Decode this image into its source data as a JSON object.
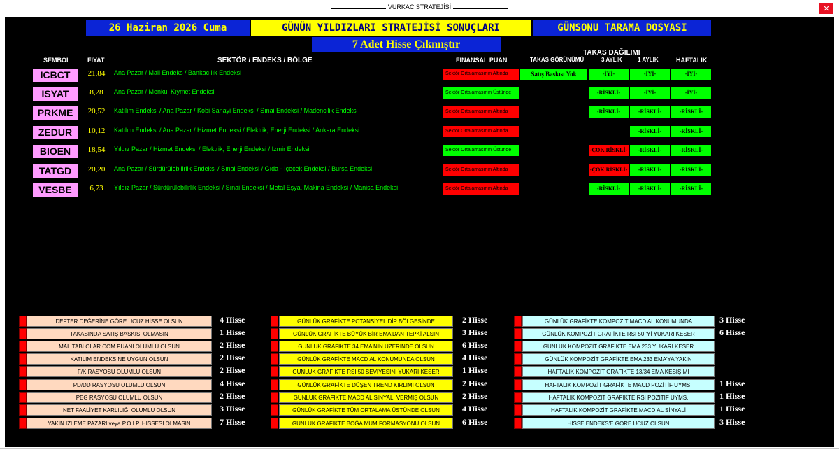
{
  "window": {
    "title": "VURKAC STRATEJİSİ",
    "close_symbol": "✕"
  },
  "header": {
    "date": "26 Haziran 2026 Cuma",
    "title": "GÜNÜN YILDIZLARI STRATEJİSİ SONUÇLARI",
    "file": "GÜNSONU TARAMA DOSYASI",
    "count_text": "7 Adet Hisse Çıkmıştır"
  },
  "columns": {
    "symbol": "SEMBOL",
    "price": "FİYAT",
    "sector": "SEKTÖR / ENDEKS / BÖLGE",
    "financial": "FİNANSAL PUAN",
    "takas_group": "TAKAS DAĞILIMI",
    "takas_view": "TAKAS GÖRÜNÜMÜ",
    "m3": "3 AYLIK",
    "m1": "1 AYLIK",
    "weekly": "HAFTALIK"
  },
  "rows": [
    {
      "symbol": "ICBCT",
      "price": "21,84",
      "sector": "Ana Pazar / Mali Endeks / Bankacılık Endeksi",
      "fin": "Sektör Ortalamasının Altında",
      "fin_status": "red",
      "takas": "Satış Baskısı Yok",
      "m3": "-İYİ-",
      "m1": "-İYİ-",
      "weekly": "-İYİ-",
      "m3_status": "green",
      "m1_status": "green",
      "weekly_status": "green"
    },
    {
      "symbol": "ISYAT",
      "price": "8,28",
      "sector": "Ana Pazar / Menkul Kıymet Endeksi",
      "fin": "Sektör Ortalamasının Üstünde",
      "fin_status": "green",
      "takas": "",
      "m3": "-RİSKLİ-",
      "m1": "-İYİ-",
      "weekly": "-İYİ-",
      "m3_status": "green",
      "m1_status": "green",
      "weekly_status": "green"
    },
    {
      "symbol": "PRKME",
      "price": "20,52",
      "sector": "Katılım Endeksi / Ana Pazar / Kobi Sanayi Endeksi / Sınai Endeksi / Madencilik Endeksi",
      "fin": "Sektör Ortalamasının Altında",
      "fin_status": "red",
      "takas": "",
      "m3": "-RİSKLİ-",
      "m1": "-RİSKLİ-",
      "weekly": "-RİSKLİ-",
      "m3_status": "green",
      "m1_status": "green",
      "weekly_status": "green"
    },
    {
      "symbol": "ZEDUR",
      "price": "10,12",
      "sector": "Katılım Endeksi / Ana Pazar / Hizmet Endeksi / Elektrik, Enerji Endeksi / Ankara Endeksi",
      "fin": "Sektör Ortalamasının Altında",
      "fin_status": "red",
      "takas": "",
      "m3": "",
      "m1": "-RİSKLİ-",
      "weekly": "-RİSKLİ-",
      "m3_status": "none",
      "m1_status": "green",
      "weekly_status": "green"
    },
    {
      "symbol": "BIOEN",
      "price": "18,54",
      "sector": "Yıldız Pazar / Hizmet Endeksi / Elektrik, Enerji Endeksi / İzmir Endeksi",
      "fin": "Sektör Ortalamasının Üstünde",
      "fin_status": "green",
      "takas": "",
      "m3": "-ÇOK RİSKLİ-",
      "m1": "-RİSKLİ-",
      "weekly": "-RİSKLİ-",
      "m3_status": "red",
      "m1_status": "green",
      "weekly_status": "green"
    },
    {
      "symbol": "TATGD",
      "price": "20,20",
      "sector": "Ana Pazar / Sürdürülebilirlik Endeksi / Sınai Endeksi / Gıda - İçecek Endeksi / Bursa Endeksi",
      "fin": "Sektör Ortalamasının Altında",
      "fin_status": "red",
      "takas": "",
      "m3": "-ÇOK RİSKLİ-",
      "m1": "-RİSKLİ-",
      "weekly": "-RİSKLİ-",
      "m3_status": "red",
      "m1_status": "green",
      "weekly_status": "green"
    },
    {
      "symbol": "VESBE",
      "price": "6,73",
      "sector": "Yıldız Pazar / Sürdürülebilirlik Endeksi / Sınai Endeksi / Metal Eşya, Makina Endeksi / Manisa Endeksi",
      "fin": "Sektör Ortalamasının Altında",
      "fin_status": "red",
      "takas": "",
      "m3": "-RİSKLİ-",
      "m1": "-RİSKLİ-",
      "weekly": "-RİSKLİ-",
      "m3_status": "green",
      "m1_status": "green",
      "weekly_status": "green"
    }
  ],
  "criteria": {
    "fundamental": [
      {
        "label": "DEFTER DEĞERİNE GÖRE UCUZ HİSSE OLSUN",
        "count": "4 Hisse"
      },
      {
        "label": "TAKASINDA SATIŞ BASKISI OLMASIN",
        "count": "1 Hisse"
      },
      {
        "label": "MALİTABLOLAR.COM PUANI OLUMLU OLSUN",
        "count": "2 Hisse"
      },
      {
        "label": "KATILIM ENDEKSİNE UYGUN OLSUN",
        "count": "2 Hisse"
      },
      {
        "label": "F/K RASYOSU OLUMLU OLSUN",
        "count": "2 Hisse"
      },
      {
        "label": "PD/DD RASYOSU OLUMLU OLSUN",
        "count": "4 Hisse"
      },
      {
        "label": "PEG RASYOSU OLUMLU OLSUN",
        "count": "2 Hisse"
      },
      {
        "label": "NET FAALİYET KARLILIĞI OLUMLU OLSUN",
        "count": "3 Hisse"
      },
      {
        "label": "YAKIN İZLEME PAZARI veya P.O.İ.P. HİSSESİ OLMASIN",
        "count": "7 Hisse"
      }
    ],
    "daily": [
      {
        "label": "GÜNLÜK GRAFİKTE POTANSİYEL DİP BÖLGESİNDE",
        "count": "2 Hisse"
      },
      {
        "label": "GÜNLÜK GRAFİKTE BÜYÜK BİR EMA'DAN TEPKİ ALSIN",
        "count": "3 Hisse"
      },
      {
        "label": "GÜNLÜK GRAFİKTE 34 EMA'NIN ÜZERİNDE OLSUN",
        "count": "6 Hisse"
      },
      {
        "label": "GÜNLÜK GRAFİKTE MACD AL KONUMUNDA OLSUN",
        "count": "4 Hisse"
      },
      {
        "label": "GÜNLÜK GRAFİKTE RSI 50 SEVİYESİNİ YUKARI KESER",
        "count": "1 Hisse"
      },
      {
        "label": "GÜNLÜK GRAFİKTE DÜŞEN TREND KIRLIMI OLSUN",
        "count": "2 Hisse"
      },
      {
        "label": "GÜNLÜK GRAFİKTE MACD AL SİNYALİ VERMİŞ OLSUN",
        "count": "2 Hisse"
      },
      {
        "label": "GÜNLÜK GRAFİKTE TÜM ORTALAMA ÜSTÜNDE OLSUN",
        "count": "4 Hisse"
      },
      {
        "label": "GÜNLÜK GRAFİKTE BOĞA MUM FORMASYONU OLSUN",
        "count": "6 Hisse"
      }
    ],
    "composite": [
      {
        "label": "GÜNLÜK GRAFİKTE KOMPOZİT MACD AL KONUMUNDA",
        "count": "3 Hisse"
      },
      {
        "label": "GÜNLÜK KOMPOZİT GRAFİKTE RSI 50 'Yİ YUKARI KESER",
        "count": "6 Hisse"
      },
      {
        "label": "GÜNLÜK KOMPOZİT GRAFİKTE EMA 233 YUKARI KESER",
        "count": ""
      },
      {
        "label": "GÜNLÜK KOMPOZİT GRAFİKTE EMA 233 EMA'YA YAKIN",
        "count": ""
      },
      {
        "label": "HAFTALIK KOMPOZİT GRAFİKTE 13/34 EMA KESİŞİMİ",
        "count": ""
      },
      {
        "label": "HAFTALIK KOMPOZİT GRAFİKTE MACD POZİTİF UYMS.",
        "count": "1 Hisse"
      },
      {
        "label": "HAFTALIK KOMPOZİT GRAFİKTE RSI POZİTİF UYMS.",
        "count": "1 Hisse"
      },
      {
        "label": "HAFTALIK KOMPOZİT GRAFİKTE MACD AL SİNYALİ",
        "count": "1 Hisse"
      },
      {
        "label": "HİSSE ENDEKS'E GÖRE UCUZ OLSUN",
        "count": "3 Hisse"
      }
    ]
  },
  "colors": {
    "red": "#ff0000",
    "green": "#00ff00",
    "frame": "#000000",
    "header_blue": "#0b24d6",
    "header_yellow": "#ffff00"
  }
}
